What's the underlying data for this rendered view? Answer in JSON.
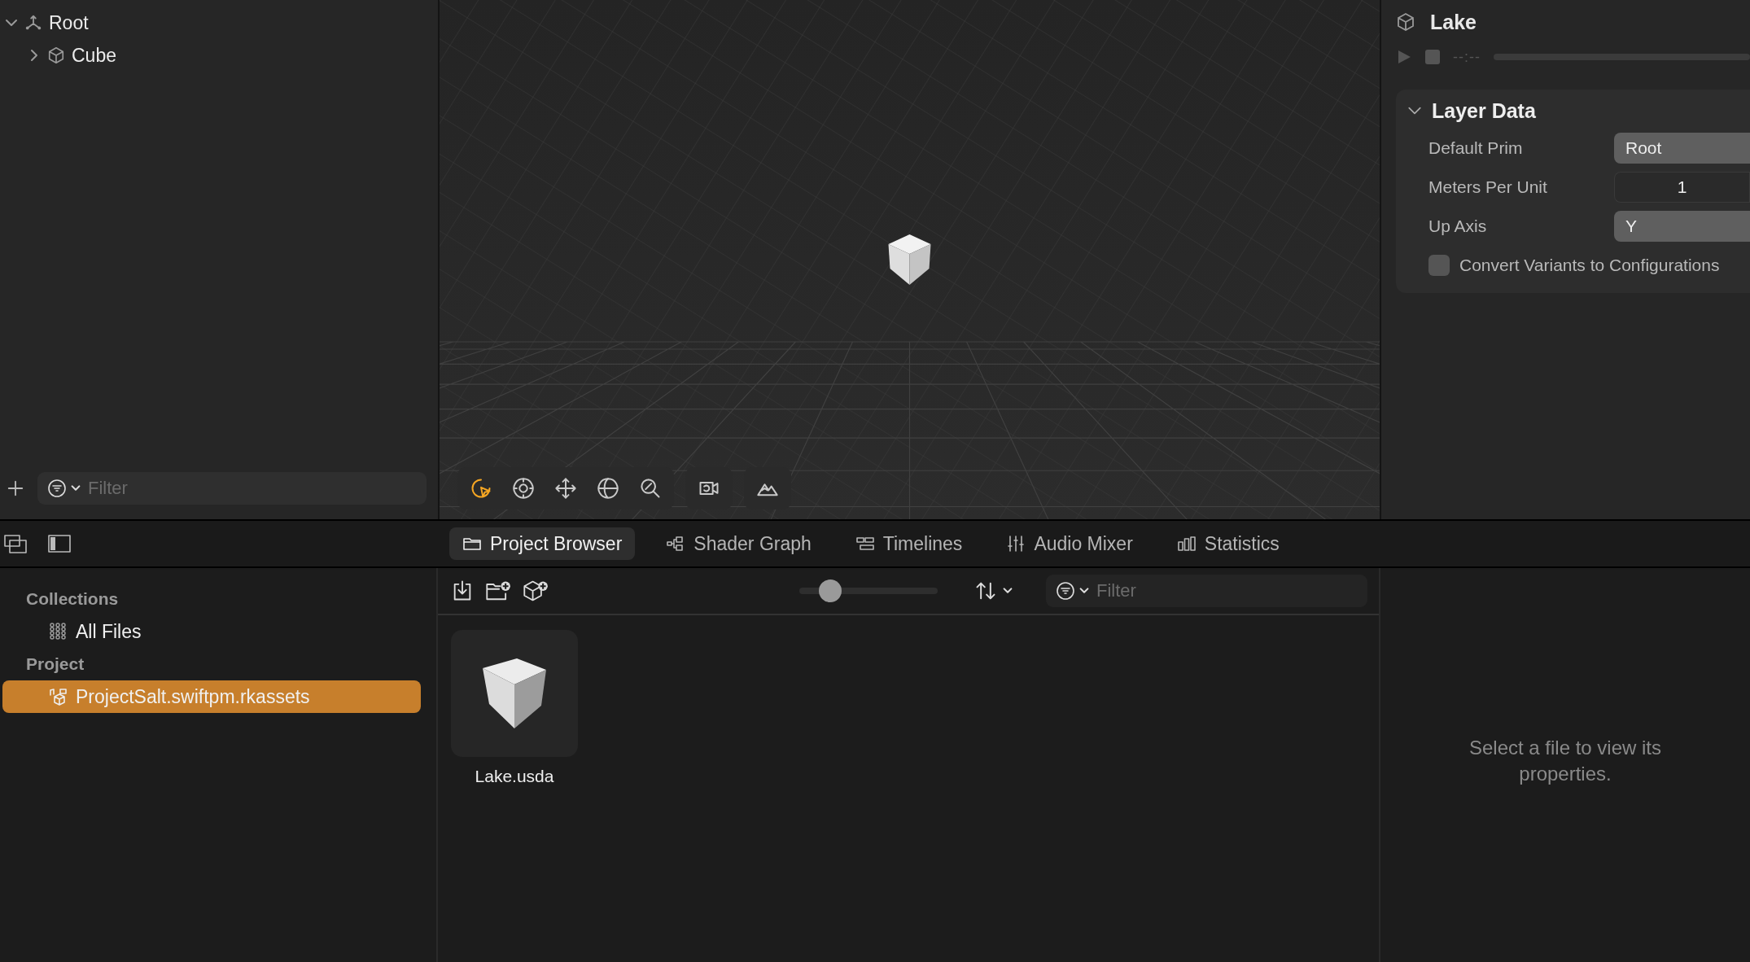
{
  "scene_tree": [
    {
      "label": "Root",
      "kind": "root",
      "expanded": true,
      "children": [
        {
          "label": "Cube",
          "kind": "model",
          "expanded": false
        }
      ]
    }
  ],
  "scene_filter": {
    "placeholder": "Filter"
  },
  "viewport_tools": [
    {
      "kind": "select",
      "selected": true
    },
    {
      "kind": "orbit",
      "selected": false
    },
    {
      "kind": "move",
      "selected": false
    },
    {
      "kind": "rotate",
      "selected": false
    },
    {
      "kind": "zoom",
      "selected": false
    },
    {
      "kind": "camera",
      "selected": false
    },
    {
      "kind": "terrain",
      "selected": false
    }
  ],
  "inspector": {
    "title": "Lake",
    "timecode": "--:--",
    "section": {
      "title": "Layer Data",
      "expanded": true,
      "fields": [
        {
          "label": "Default Prim",
          "kind": "popup",
          "value": "Root"
        },
        {
          "label": "Meters Per Unit",
          "kind": "number",
          "value": "1"
        },
        {
          "label": "Up Axis",
          "kind": "popup",
          "value": "Y"
        },
        {
          "label": "Convert Variants to Configurations",
          "kind": "checkbox",
          "checked": false
        }
      ]
    }
  },
  "tabs": [
    {
      "label": "Project Browser",
      "kind": "folder",
      "selected": true
    },
    {
      "label": "Shader Graph",
      "kind": "graph",
      "selected": false
    },
    {
      "label": "Timelines",
      "kind": "timeline",
      "selected": false
    },
    {
      "label": "Audio Mixer",
      "kind": "mixer",
      "selected": false
    },
    {
      "label": "Statistics",
      "kind": "stats",
      "selected": false
    }
  ],
  "sidebar": [
    {
      "heading": "Collections",
      "items": [
        {
          "label": "All Files",
          "kind": "grid",
          "selected": false
        }
      ]
    },
    {
      "heading": "Project",
      "items": [
        {
          "label": "ProjectSalt.swiftpm.rkassets",
          "kind": "assets",
          "selected": true
        }
      ]
    }
  ],
  "browser": {
    "zoom": {
      "level": 0.2
    },
    "filter": {
      "placeholder": "Filter"
    },
    "files": [
      {
        "name": "Lake.usda",
        "selected": false
      }
    ]
  },
  "file_inspector": {
    "message": "Select a file to view its properties."
  }
}
